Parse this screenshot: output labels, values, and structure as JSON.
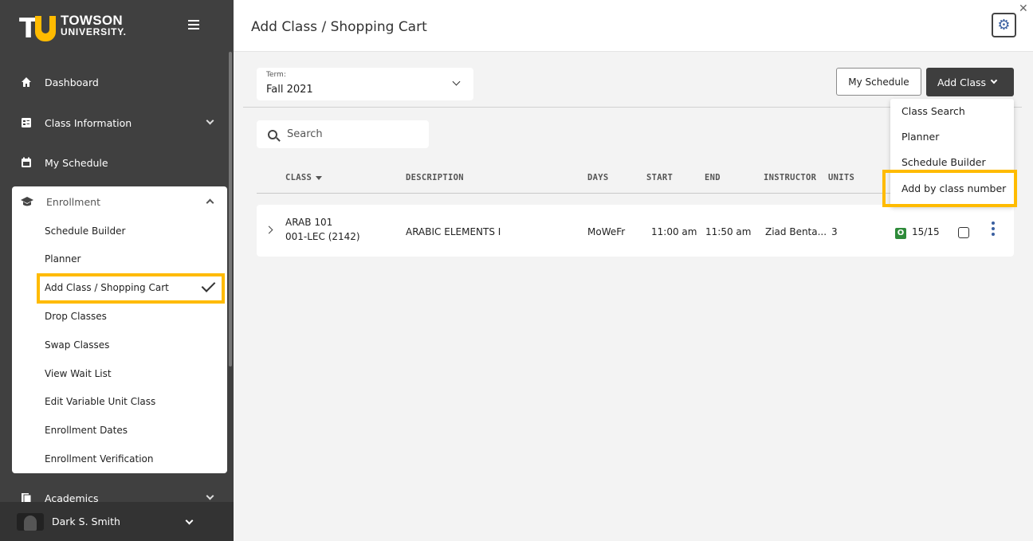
{
  "sidebar": {
    "logo": {
      "line1": "TOWSON",
      "line2": "UNIVERSITY."
    },
    "items": [
      {
        "label": "Dashboard",
        "icon": "home-icon"
      },
      {
        "label": "Class Information",
        "icon": "class-info-icon"
      },
      {
        "label": "My Schedule",
        "icon": "calendar-icon"
      }
    ],
    "enrollment": {
      "label": "Enrollment",
      "icon": "graduation-cap-icon",
      "subitems": [
        "Schedule Builder",
        "Planner",
        "Add Class / Shopping Cart",
        "Drop Classes",
        "Swap Classes",
        "View Wait List",
        "Edit Variable Unit Class",
        "Enrollment Dates",
        "Enrollment Verification"
      ],
      "selected": "Add Class / Shopping Cart"
    },
    "academics": {
      "label": "Academics",
      "icon": "academics-icon"
    },
    "user": {
      "name": "Dark S. Smith"
    }
  },
  "header": {
    "title": "Add Class / Shopping Cart"
  },
  "term": {
    "label": "Term:",
    "value": "Fall 2021"
  },
  "buttons": {
    "my_schedule": "My Schedule",
    "add_class": "Add Class"
  },
  "search": {
    "placeholder": "Search"
  },
  "table": {
    "columns": [
      "CLASS",
      "DESCRIPTION",
      "DAYS",
      "START",
      "END",
      "INSTRUCTOR",
      "UNITS"
    ],
    "rows": [
      {
        "class_code": "ARAB 101",
        "section": "001-LEC (2142)",
        "description": "ARABIC ELEMENTS I",
        "days": "MoWeFr",
        "start": "11:00 am",
        "end": "11:50 am",
        "instructor": "Ziad Benta...",
        "units": "3",
        "seat_badge": "O",
        "seats": "15/15"
      }
    ]
  },
  "add_class_menu": [
    "Class Search",
    "Planner",
    "Schedule Builder",
    "Add by class number"
  ],
  "colors": {
    "accent": "#ffbb00",
    "sidebar": "#404040",
    "open_badge": "#2e8b3a",
    "link": "#3a5fa0"
  }
}
